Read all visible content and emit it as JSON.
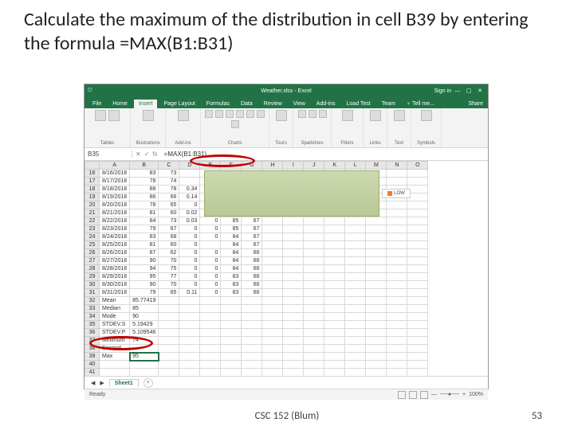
{
  "slide": {
    "title": "Calculate the maximum of the distribution in cell B39 by entering the formula =MAX(B1:B31)",
    "footer_center": "CSC 152 (Blum)",
    "footer_right": "53"
  },
  "titlebar": {
    "app_title": "Weather.xlsx - Excel",
    "signin": "Sign in"
  },
  "ribbon": {
    "file": "File",
    "tabs": [
      "Home",
      "Insert",
      "Page Layout",
      "Formulas",
      "Data",
      "Review",
      "View",
      "Add-ins",
      "Load Test",
      "Team"
    ],
    "active_tab_index": 1,
    "tellme": "Tell me...",
    "share": "Share",
    "groups": [
      "Tables",
      "Illustrations",
      "Add-ins",
      "Charts",
      "Tours",
      "Sparklines",
      "Filters",
      "Links",
      "Text",
      "Symbols"
    ]
  },
  "fbar": {
    "namebox": "B35",
    "fx": "fx",
    "formula": "=MAX(B1:B31)"
  },
  "columns": [
    "A",
    "B",
    "C",
    "D",
    "E",
    "F",
    "G",
    "H",
    "I",
    "J",
    "K",
    "L",
    "M",
    "N",
    "O"
  ],
  "rows": [
    {
      "n": 16,
      "a": "8/16/2018",
      "b": "83",
      "c": "73",
      "d": ""
    },
    {
      "n": 17,
      "a": "8/17/2018",
      "b": "78",
      "c": "74",
      "d": ""
    },
    {
      "n": 18,
      "a": "8/18/2018",
      "b": "88",
      "c": "78",
      "d": "0.34"
    },
    {
      "n": 19,
      "a": "8/19/2018",
      "b": "86",
      "c": "66",
      "d": "0.14"
    },
    {
      "n": 20,
      "a": "8/20/2018",
      "b": "78",
      "c": "65",
      "d": "0"
    },
    {
      "n": 21,
      "a": "8/21/2018",
      "b": "81",
      "c": "60",
      "d": "0.02"
    },
    {
      "n": 22,
      "a": "8/22/2018",
      "b": "84",
      "c": "73",
      "d": "0.03",
      "e": "0",
      "f": "85",
      "g": "67"
    },
    {
      "n": 23,
      "a": "8/23/2018",
      "b": "79",
      "c": "67",
      "d": "0",
      "e": "0",
      "f": "85",
      "g": "67"
    },
    {
      "n": 24,
      "a": "8/24/2018",
      "b": "83",
      "c": "68",
      "d": "0",
      "e": "0",
      "f": "84",
      "g": "67"
    },
    {
      "n": 25,
      "a": "8/25/2018",
      "b": "81",
      "c": "60",
      "d": "0",
      "e": "",
      "f": "84",
      "g": "67"
    },
    {
      "n": 26,
      "a": "8/26/2018",
      "b": "87",
      "c": "62",
      "d": "0",
      "e": "0",
      "f": "84",
      "g": "66"
    },
    {
      "n": 27,
      "a": "8/27/2018",
      "b": "90",
      "c": "70",
      "d": "0",
      "e": "0",
      "f": "84",
      "g": "66"
    },
    {
      "n": 28,
      "a": "8/28/2018",
      "b": "94",
      "c": "75",
      "d": "0",
      "e": "0",
      "f": "84",
      "g": "66"
    },
    {
      "n": 29,
      "a": "8/29/2018",
      "b": "95",
      "c": "77",
      "d": "0",
      "e": "0",
      "f": "83",
      "g": "66"
    },
    {
      "n": 30,
      "a": "8/30/2018",
      "b": "90",
      "c": "70",
      "d": "0",
      "e": "0",
      "f": "83",
      "g": "66"
    },
    {
      "n": 31,
      "a": "8/31/2018",
      "b": "79",
      "c": "65",
      "d": "0.11",
      "e": "0",
      "f": "83",
      "g": "66"
    }
  ],
  "stats": [
    {
      "n": 32,
      "lbl": "Mean",
      "val": "85.77419"
    },
    {
      "n": 33,
      "lbl": "Median",
      "val": "85"
    },
    {
      "n": 34,
      "lbl": "Mode",
      "val": "90"
    },
    {
      "n": 35,
      "lbl": "STDEV.S",
      "val": "5.19429"
    },
    {
      "n": 36,
      "lbl": "STDEV.P",
      "val": "5.109546"
    },
    {
      "n": 37,
      "lbl": "Minimum",
      "val": "74"
    },
    {
      "n": 38,
      "lbl": "Second",
      "val": ""
    },
    {
      "n": 39,
      "lbl": "Max",
      "val": "95"
    },
    {
      "n": 40,
      "lbl": "",
      "val": ""
    },
    {
      "n": 41,
      "lbl": "",
      "val": ""
    }
  ],
  "chart": {
    "legend": "LOW"
  },
  "sheettab": {
    "name": "Sheet1",
    "add": "+"
  },
  "status": {
    "ready": "Ready",
    "zoom": "100%"
  }
}
